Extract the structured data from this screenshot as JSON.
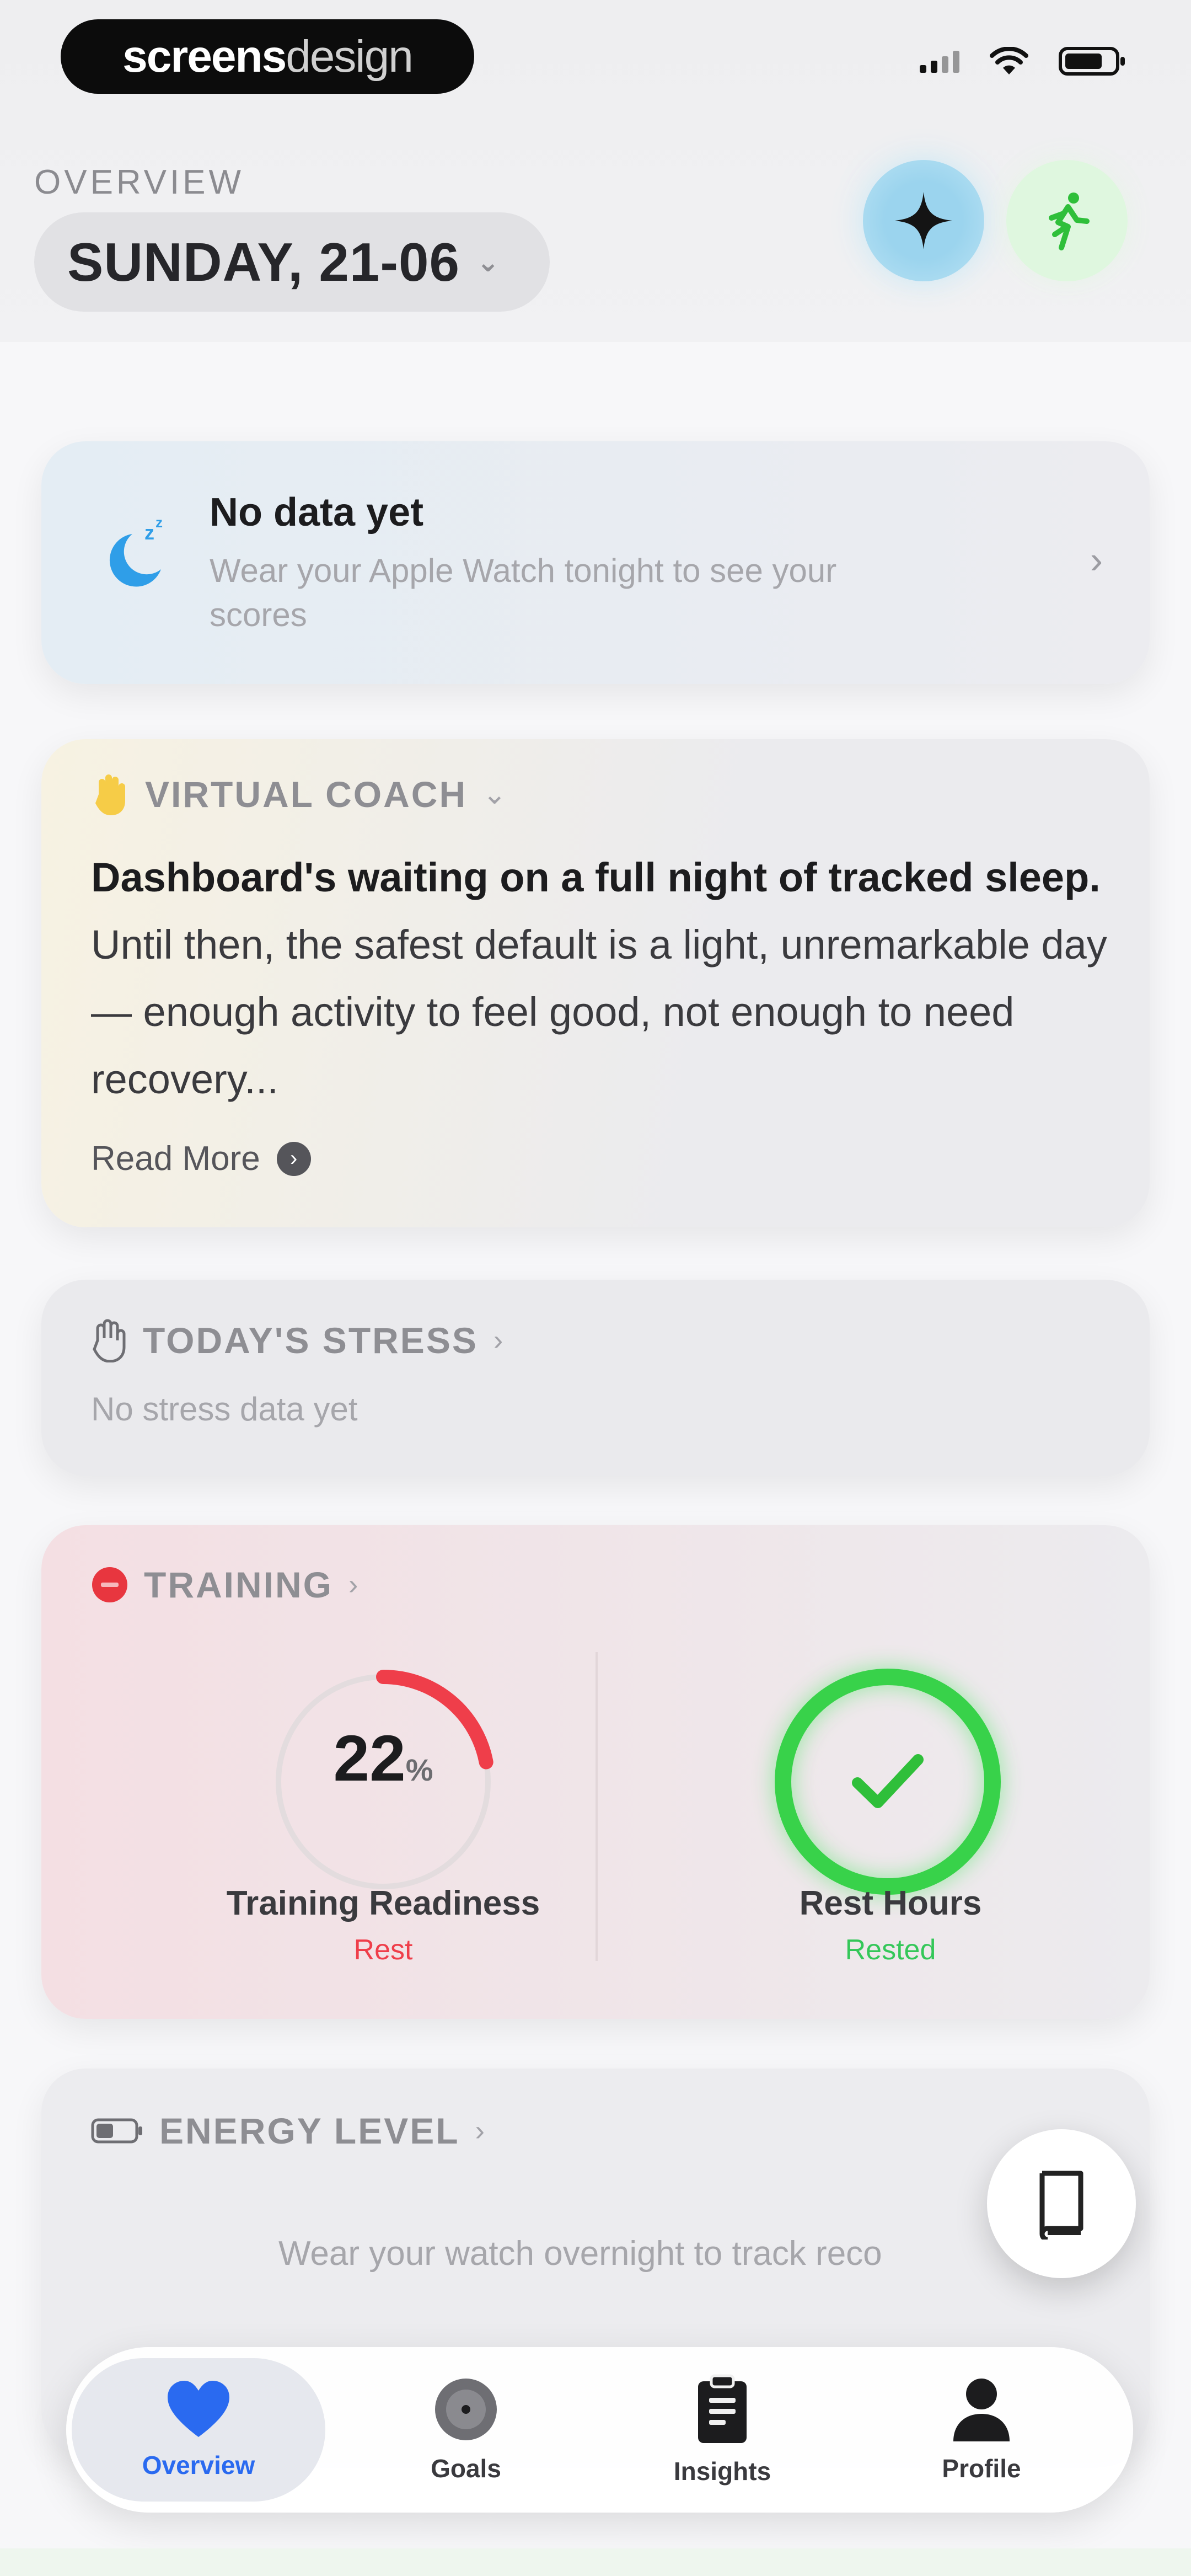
{
  "brand": {
    "bold": "screens",
    "thin": "design"
  },
  "header": {
    "section_label": "OVERVIEW",
    "date": "SUNDAY, 21-06"
  },
  "icons": {
    "sparkle": "sparkle-icon",
    "run": "running-figure-icon",
    "moon": "moon-sleep-icon",
    "coach": "hand-icon",
    "stress": "hand-stress-icon",
    "training": "training-icon",
    "energy": "battery-icon",
    "book": "book-icon"
  },
  "no_data_card": {
    "title": "No data yet",
    "subtitle": "Wear your Apple Watch tonight to see your scores"
  },
  "virtual_coach": {
    "label": "VIRTUAL COACH",
    "bold_text": "Dashboard's waiting on a full night of tracked sleep.",
    "text": " Until then, the safest default is a light, unremarkable day — enough activity to feel good, not enough to need recovery...",
    "read_more": "Read More"
  },
  "stress": {
    "label": "TODAY'S STRESS",
    "subtitle": "No stress data yet"
  },
  "training": {
    "label": "TRAINING",
    "readiness": {
      "value": "22",
      "unit": "%",
      "label": "Training Readiness",
      "status": "Rest",
      "percent": 22,
      "color": "#ef3e4a"
    },
    "rest_hours": {
      "label": "Rest Hours",
      "status": "Rested",
      "color": "#34c759"
    }
  },
  "energy": {
    "label": "ENERGY LEVEL",
    "subtitle": "Wear your watch overnight to track reco"
  },
  "tabs": [
    {
      "label": "Overview",
      "active": true
    },
    {
      "label": "Goals",
      "active": false
    },
    {
      "label": "Insights",
      "active": false
    },
    {
      "label": "Profile",
      "active": false
    }
  ],
  "colors": {
    "accent": "#2a6af0",
    "rest": "#ef3e4a",
    "rested": "#34c759"
  }
}
